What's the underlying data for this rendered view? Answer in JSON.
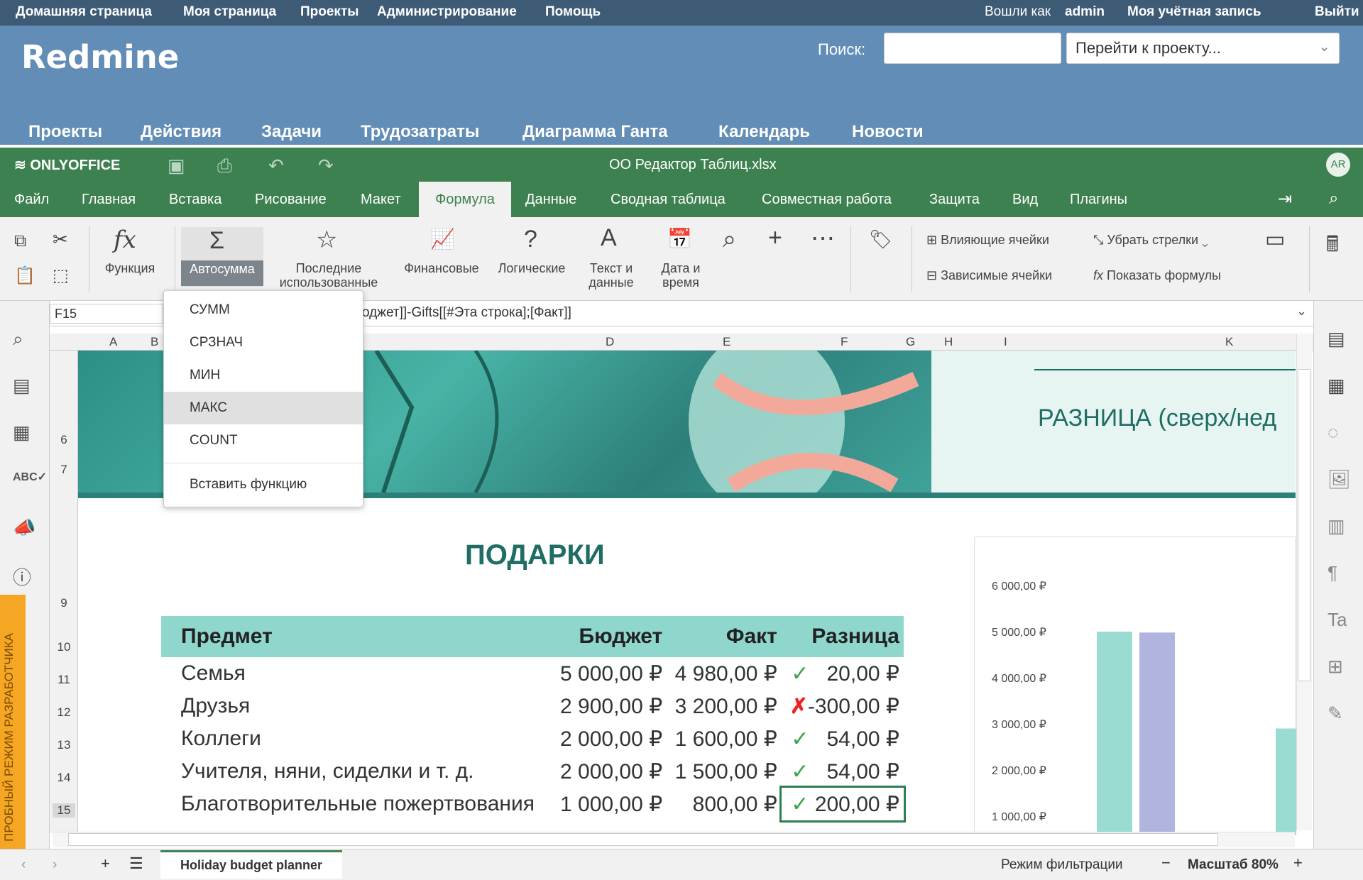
{
  "redmine": {
    "top_links": [
      "Домашняя страница",
      "Моя страница",
      "Проекты",
      "Администрирование",
      "Помощь"
    ],
    "logged_in_prefix": "Вошли как",
    "user": "admin",
    "account": "Моя учётная запись",
    "logout": "Выйти",
    "title": "Redmine",
    "search_label": "Поиск:",
    "search_value": "",
    "jump_placeholder": "Перейти к проекту...",
    "menu": [
      "Проекты",
      "Действия",
      "Задачи",
      "Трудозатраты",
      "Диаграмма Ганта",
      "Календарь",
      "Новости"
    ]
  },
  "oo": {
    "logo": "ONLYOFFICE",
    "doc_title": "OO Редактор Таблиц.xlsx",
    "avatar": "AR",
    "tabs": [
      "Файл",
      "Главная",
      "Вставка",
      "Рисование",
      "Макет",
      "Формула",
      "Данные",
      "Сводная таблица",
      "Совместная работа",
      "Защита",
      "Вид",
      "Плагины"
    ],
    "active_tab": "Формула",
    "toolbar": {
      "function": "Функция",
      "autosum": "Автосумма",
      "recent1": "Последние",
      "recent2": "использованные",
      "financial": "Финансовые",
      "logical": "Логические",
      "text1": "Текст и",
      "text2": "данные",
      "date1": "Дата и",
      "date2": "время",
      "precedents": "Влияющие ячейки",
      "dependents": "Зависимые ячейки",
      "remove_arrows": "Убрать стрелки",
      "show_formulas": "Показать формулы"
    },
    "namebox": "F15",
    "formula": "оджет]]-Gifts[[#Эта строка];[Факт]]",
    "columns": [
      "A",
      "B",
      "D",
      "E",
      "F",
      "G",
      "H",
      "I",
      "K"
    ],
    "rows": [
      "6",
      "7",
      "9",
      "10",
      "11",
      "12",
      "13",
      "14",
      "15"
    ],
    "dev_mode": "ПРОБНЫЙ РЕЖИМ РАЗРАБОТЧИКА",
    "dropdown": [
      "СУММ",
      "СРЗНАЧ",
      "МИН",
      "МАКС",
      "COUNT"
    ],
    "dropdown_insert": "Вставить функцию",
    "sheet_tab": "Holiday budget planner",
    "filter_mode": "Режим фильтрации",
    "zoom": "Масштаб 80%"
  },
  "sheet": {
    "diff_title": "РАЗНИЦА (сверх/нед",
    "gifts_title": "ПОДАРКИ",
    "headers": [
      "Предмет",
      "Бюджет",
      "Факт",
      "Разница"
    ],
    "rows": [
      {
        "item": "Семья",
        "budget": "5 000,00 ₽",
        "fact": "4 980,00 ₽",
        "status": "✓",
        "diff": "20,00 ₽"
      },
      {
        "item": "Друзья",
        "budget": "2 900,00 ₽",
        "fact": "3 200,00 ₽",
        "status": "✗",
        "diff": "-300,00 ₽"
      },
      {
        "item": "Коллеги",
        "budget": "2 000,00 ₽",
        "fact": "1 600,00 ₽",
        "status": "✓",
        "diff": "54,00 ₽"
      },
      {
        "item": "Учителя, няни, сиделки и т. д.",
        "budget": "2 000,00 ₽",
        "fact": "1 500,00 ₽",
        "status": "✓",
        "diff": "54,00 ₽"
      },
      {
        "item": "Благотворительные пожертвования",
        "budget": "1 000,00 ₽",
        "fact": "800,00 ₽",
        "status": "✓",
        "diff": "200,00 ₽"
      }
    ]
  },
  "chart_data": {
    "type": "bar",
    "yticks": [
      "6 000,00 ₽",
      "5 000,00 ₽",
      "4 000,00 ₽",
      "3 000,00 ₽",
      "2 000,00 ₽",
      "1 000,00 ₽"
    ],
    "ylim": [
      0,
      6000
    ],
    "series": [
      {
        "color": "#9bdcd2",
        "values": [
          5000,
          2900
        ]
      },
      {
        "color": "#b1b4de",
        "values": [
          4980
        ]
      }
    ]
  },
  "colors": {
    "redmine_top": "#3e5b76",
    "redmine_header": "#628db6",
    "oo_green": "#3e8150",
    "teal": "#1f6d63",
    "header_fill": "#8fd7cd"
  }
}
